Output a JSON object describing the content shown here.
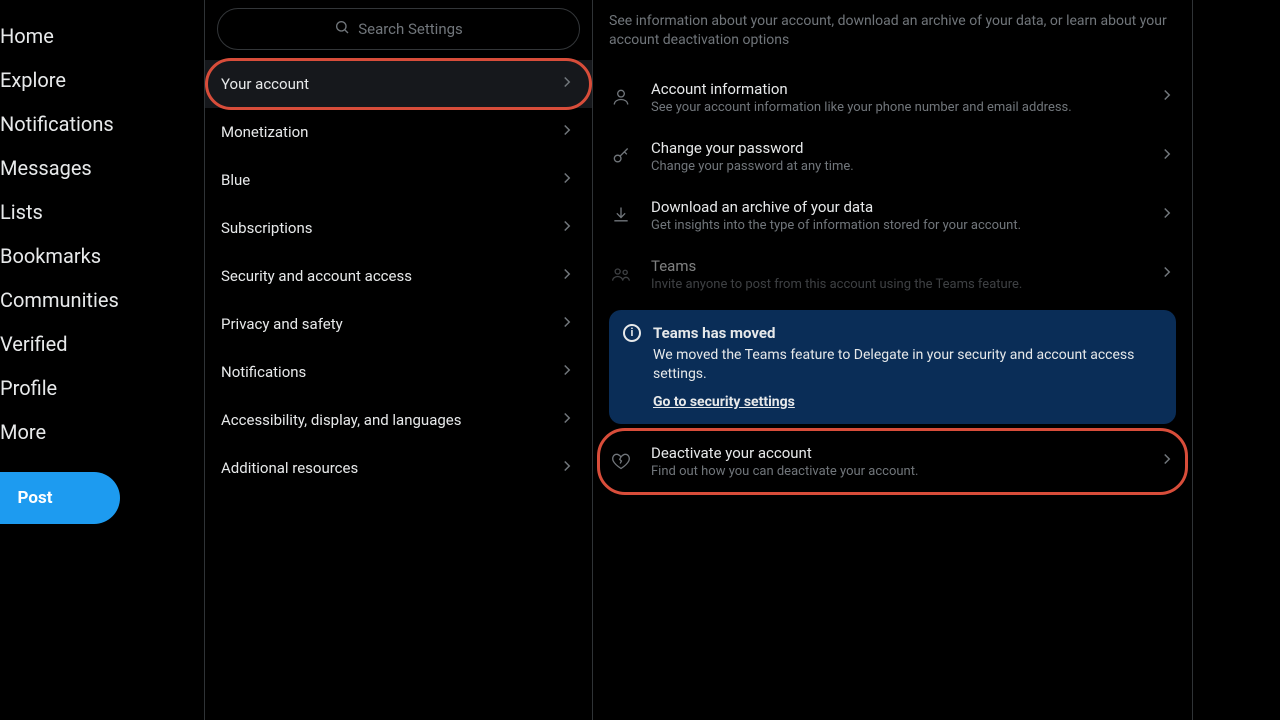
{
  "nav": {
    "items": [
      "Home",
      "Explore",
      "Notifications",
      "Messages",
      "Lists",
      "Bookmarks",
      "Communities",
      "Verified",
      "Profile",
      "More"
    ],
    "post": "Post"
  },
  "search": {
    "placeholder": "Search Settings"
  },
  "categories": [
    {
      "label": "Your account",
      "active": true,
      "highlight": true
    },
    {
      "label": "Monetization"
    },
    {
      "label": "Blue"
    },
    {
      "label": "Subscriptions"
    },
    {
      "label": "Security and account access"
    },
    {
      "label": "Privacy and safety"
    },
    {
      "label": "Notifications"
    },
    {
      "label": "Accessibility, display, and languages"
    },
    {
      "label": "Additional resources"
    }
  ],
  "detail": {
    "description": "See information about your account, download an archive of your data, or learn about your account deactivation options",
    "items": [
      {
        "icon": "user-icon",
        "title": "Account information",
        "sub": "See your account information like your phone number and email address."
      },
      {
        "icon": "key-icon",
        "title": "Change your password",
        "sub": "Change your password at any time."
      },
      {
        "icon": "download-icon",
        "title": "Download an archive of your data",
        "sub": "Get insights into the type of information stored for your account."
      },
      {
        "icon": "people-icon",
        "title": "Teams",
        "sub": "Invite anyone to post from this account using the Teams feature.",
        "dim": true
      }
    ],
    "banner": {
      "title": "Teams has moved",
      "message": "We moved the Teams feature to Delegate in your security and account access settings.",
      "link": "Go to security settings"
    },
    "deactivate": {
      "icon": "heartbreak-icon",
      "title": "Deactivate your account",
      "sub": "Find out how you can deactivate your account.",
      "highlight": true
    }
  }
}
